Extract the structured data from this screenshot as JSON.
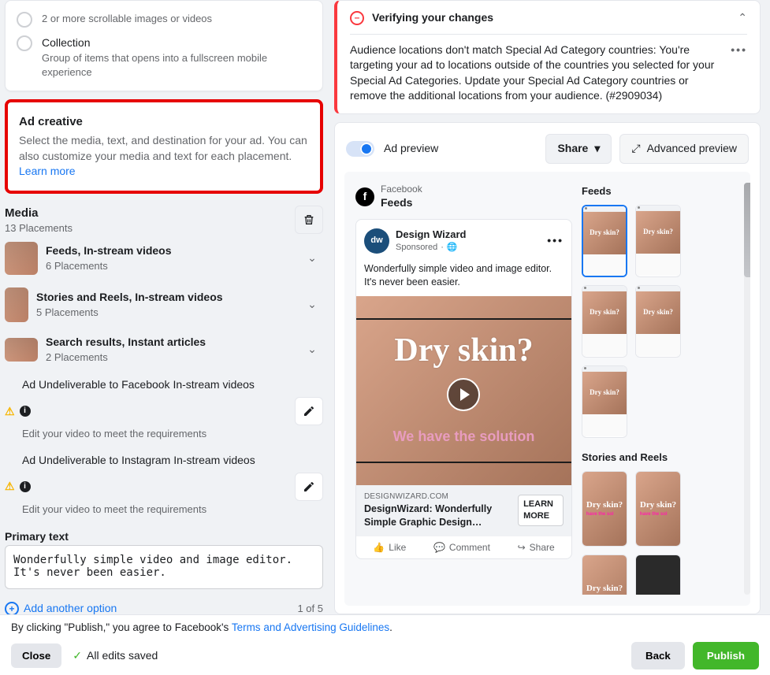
{
  "left": {
    "formats": {
      "carousel_sub": "2 or more scrollable images or videos",
      "collection_title": "Collection",
      "collection_sub": "Group of items that opens into a fullscreen mobile experience"
    },
    "ad_creative": {
      "title": "Ad creative",
      "desc": "Select the media, text, and destination for your ad. You can also customize your media and text for each placement.",
      "learn_more": "Learn more"
    },
    "media": {
      "title": "Media",
      "placements_count": "13 Placements",
      "groups": [
        {
          "title": "Feeds, In-stream videos",
          "sub": "6 Placements"
        },
        {
          "title": "Stories and Reels, In-stream videos",
          "sub": "5 Placements"
        },
        {
          "title": "Search results, Instant articles",
          "sub": "2 Placements"
        }
      ],
      "warnings": [
        {
          "title": "Ad Undeliverable to Facebook In-stream videos",
          "help": "Edit your video to meet the requirements"
        },
        {
          "title": "Ad Undeliverable to Instagram In-stream videos",
          "help": "Edit your video to meet the requirements"
        }
      ]
    },
    "primary": {
      "label": "Primary text",
      "value": "Wonderfully simple video and image editor. It's never been easier.",
      "add_option": "Add another option",
      "counter": "1 of 5"
    }
  },
  "right": {
    "alert": {
      "title": "Verifying your changes",
      "body": "Audience locations don't match Special Ad Category countries: You're targeting your ad to locations outside of the countries you selected for your Special Ad Categories. Update your Special Ad Category countries or remove the additional locations from your audience. (#2909034)"
    },
    "preview_bar": {
      "label": "Ad preview",
      "share": "Share",
      "advanced": "Advanced preview"
    },
    "post": {
      "platform_small": "Facebook",
      "platform_big": "Feeds",
      "page_name": "Design Wizard",
      "sponsored": "Sponsored",
      "text": "Wonderfully simple video and image editor. It's never been easier.",
      "headline_overlay": "Dry skin?",
      "sub_overlay": "We have the solution",
      "domain": "DESIGNWIZARD.COM",
      "link_title": "DesignWizard: Wonderfully Simple Graphic Design…",
      "cta": "LEARN MORE",
      "like": "Like",
      "comment": "Comment",
      "share": "Share"
    },
    "side": {
      "feeds_title": "Feeds",
      "stories_title": "Stories and Reels",
      "tile_text": "Dry skin?",
      "tile_sub": "have the sol"
    }
  },
  "footer": {
    "pretext": "By clicking \"Publish,\" you agree to Facebook's ",
    "link": "Terms and Advertising Guidelines",
    "period": ".",
    "close": "Close",
    "saved": "All edits saved",
    "back": "Back",
    "publish": "Publish"
  }
}
